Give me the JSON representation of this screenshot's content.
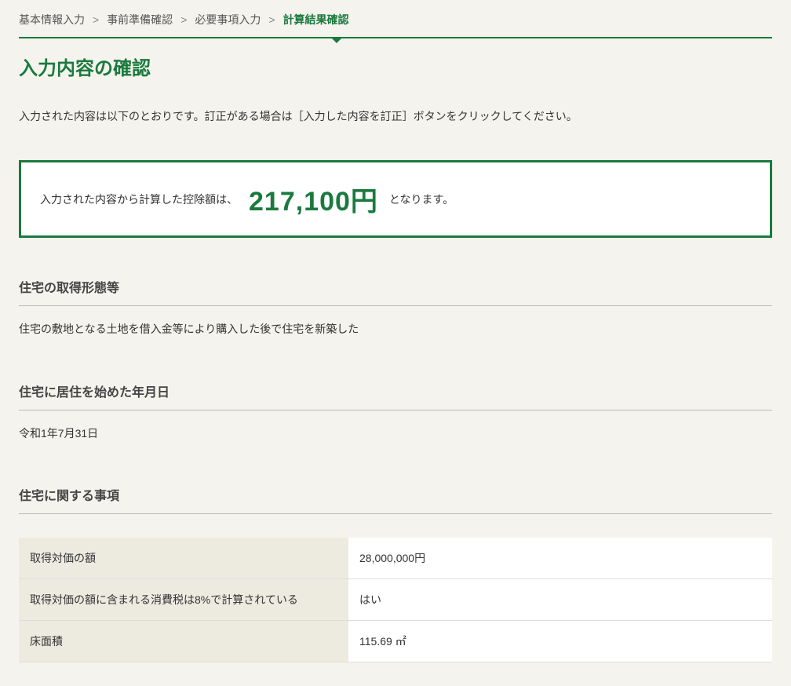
{
  "breadcrumb": {
    "items": [
      {
        "label": "基本情報入力",
        "active": false
      },
      {
        "label": "事前準備確認",
        "active": false
      },
      {
        "label": "必要事項入力",
        "active": false
      },
      {
        "label": "計算結果確認",
        "active": true
      }
    ]
  },
  "page_title": "入力内容の確認",
  "intro_text": "入力された内容は以下のとおりです。訂正がある場合は［入力した内容を訂正］ボタンをクリックしてください。",
  "result": {
    "prefix": "入力された内容から計算した控除額は、",
    "amount": "217,100円",
    "suffix": "となります。"
  },
  "sections": {
    "acquisition_form": {
      "heading": "住宅の取得形態等",
      "value": "住宅の敷地となる土地を借入金等により購入した後で住宅を新築した"
    },
    "residence_date": {
      "heading": "住宅に居住を始めた年月日",
      "value": "令和1年7月31日"
    },
    "house_details": {
      "heading": "住宅に関する事項",
      "rows": [
        {
          "label": "取得対価の額",
          "value": "28,000,000円"
        },
        {
          "label": "取得対価の額に含まれる消費税は8%で計算されている",
          "value": "はい"
        },
        {
          "label": "床面積",
          "value": "115.69 ㎡"
        }
      ]
    }
  }
}
